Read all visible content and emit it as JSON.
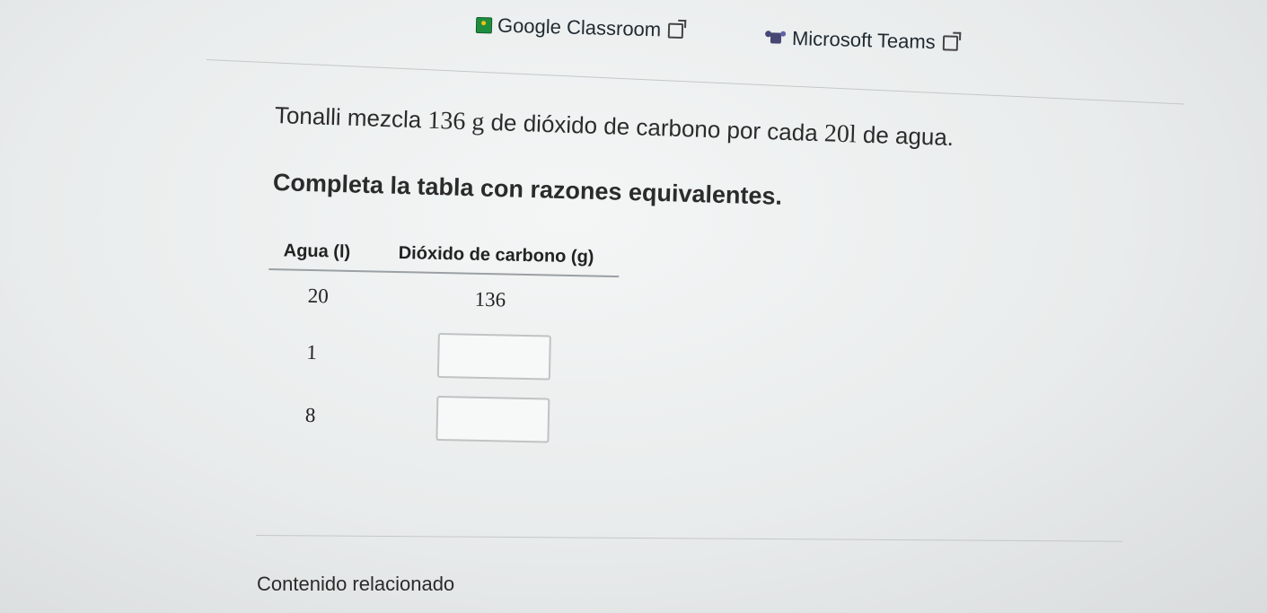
{
  "share": {
    "google_classroom": "Google Classroom",
    "microsoft_teams": "Microsoft Teams"
  },
  "problem": {
    "part1": "Tonalli mezcla ",
    "amount": "136",
    "unit_g": " g",
    "part2": " de dióxido de carbono por cada ",
    "water": "20",
    "unit_l": "l",
    "part3": " de agua.",
    "instruction": "Completa la tabla con razones equivalentes."
  },
  "table": {
    "headers": [
      "Agua (l)",
      "Dióxido de carbono (g)"
    ],
    "rows": [
      {
        "agua": "20",
        "dioxido": "136"
      },
      {
        "agua": "1",
        "dioxido": ""
      },
      {
        "agua": "8",
        "dioxido": ""
      }
    ]
  },
  "related": {
    "title": "Contenido relacionado"
  },
  "icons": {
    "classroom": "google-classroom-icon",
    "teams": "microsoft-teams-icon",
    "external": "external-link-icon"
  }
}
